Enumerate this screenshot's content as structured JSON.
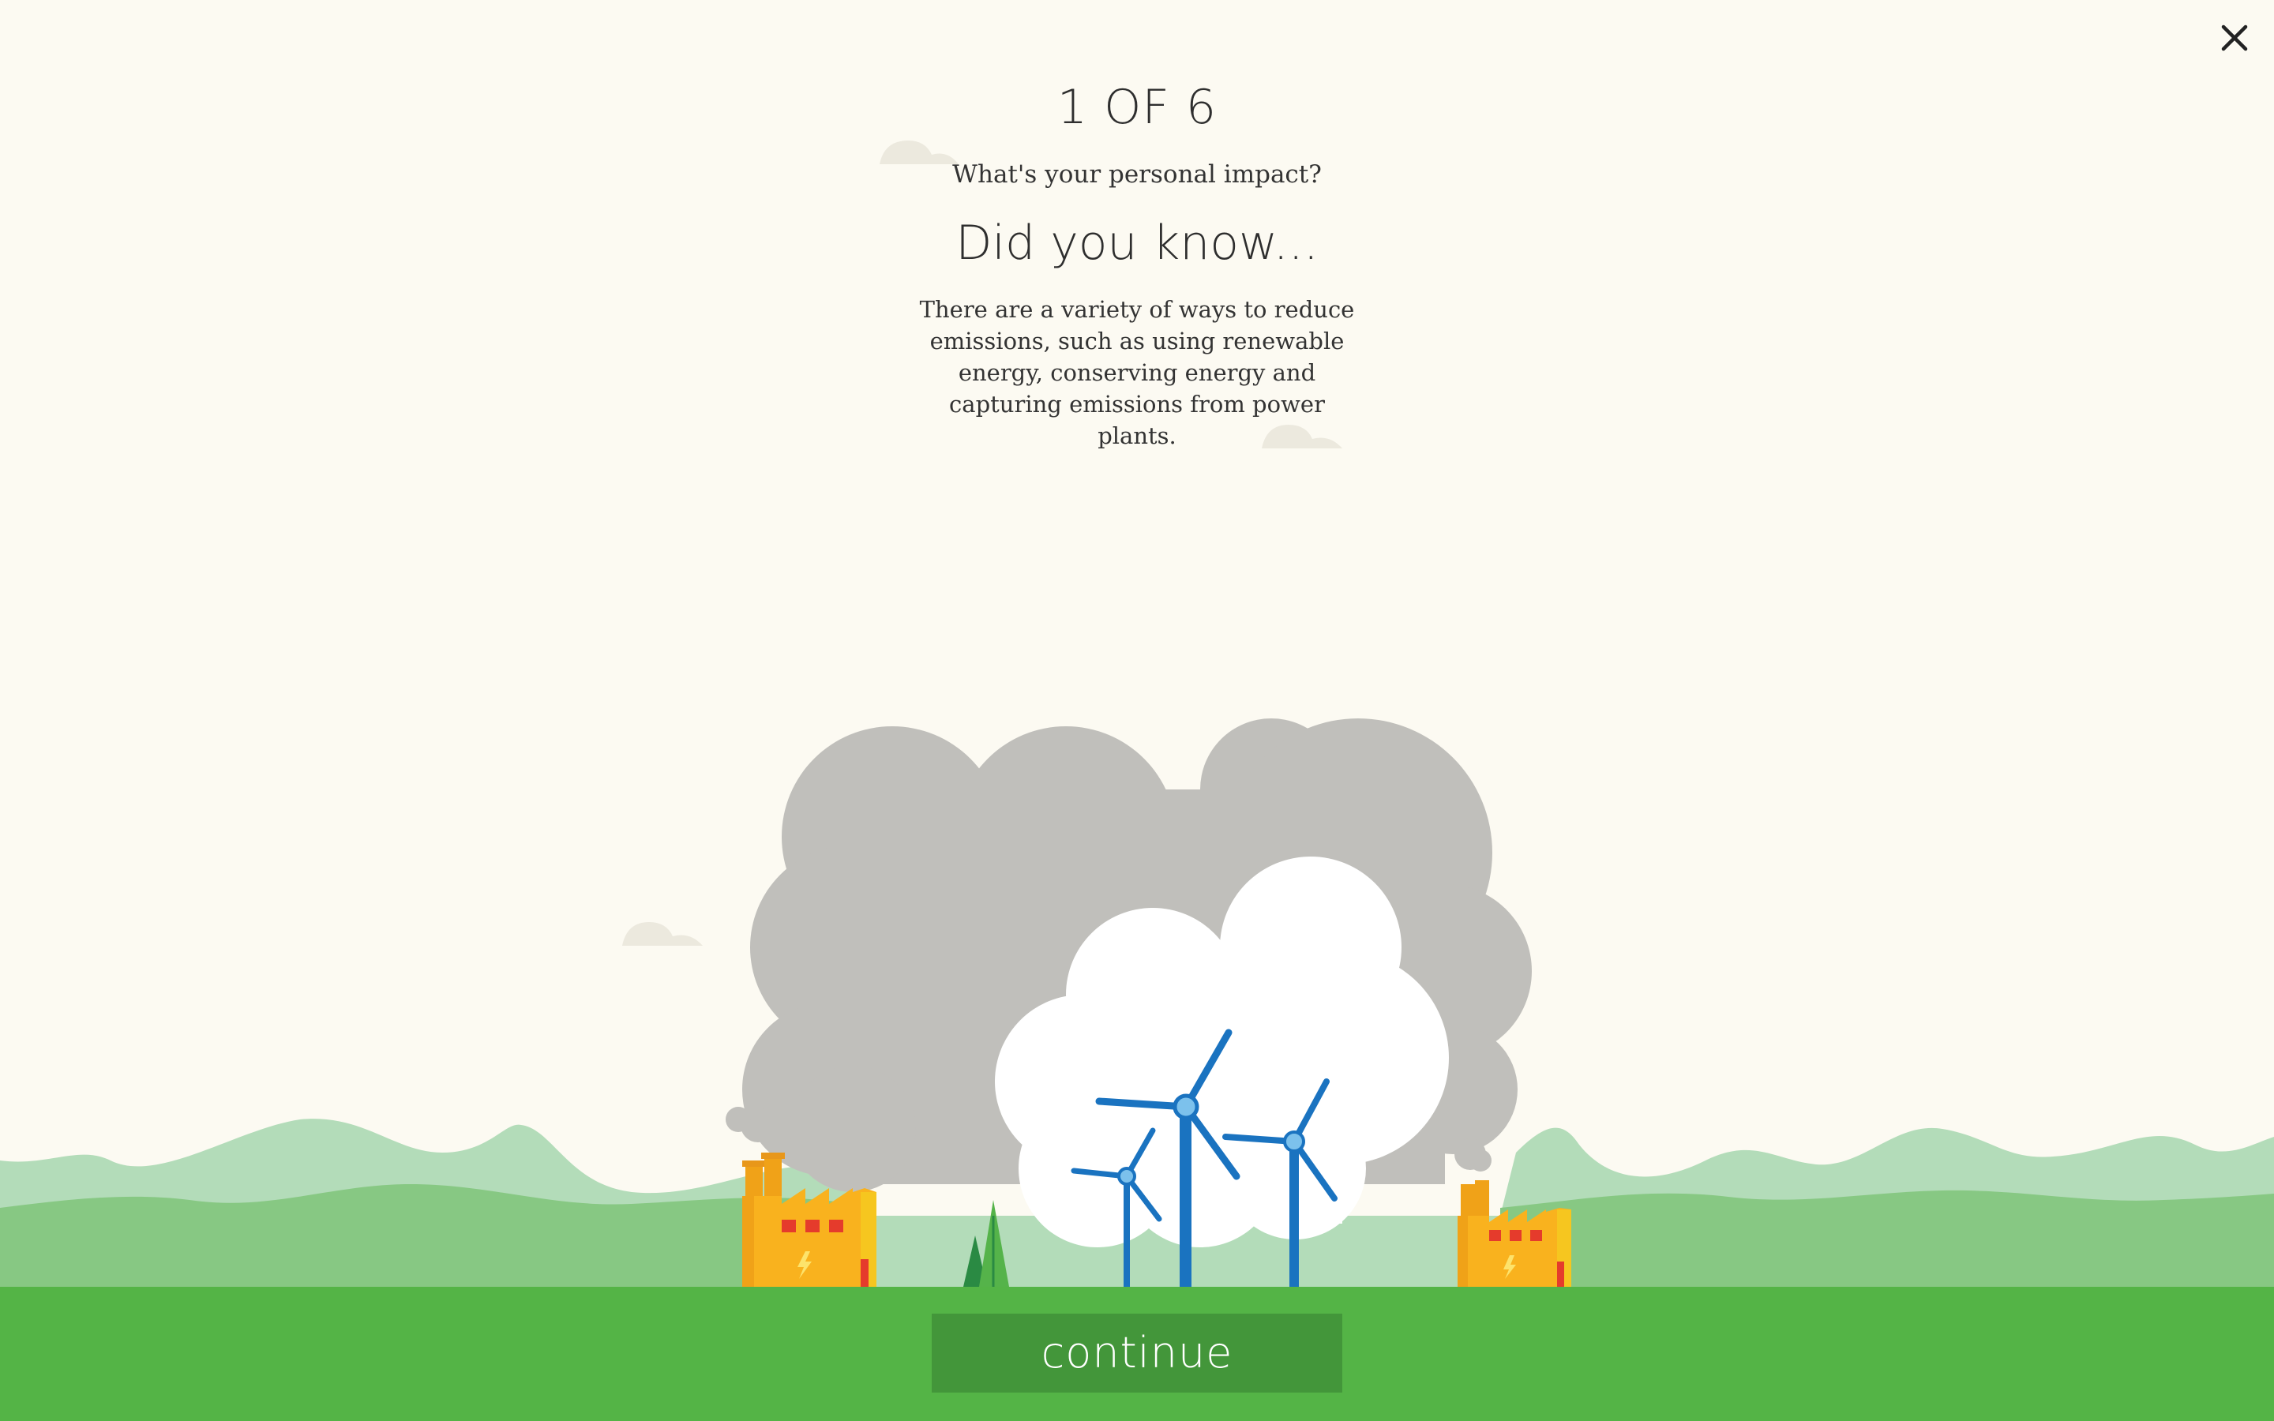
{
  "progress": {
    "text": "1 OF 6",
    "current": 1,
    "total": 6
  },
  "subtitle": "What's your personal impact?",
  "heading": "Did you know...",
  "body": "There are a variety of ways to reduce emissions, such as using renewable energy, conserving energy and capturing emissions from power plants.",
  "continue_label": "continue",
  "close_icon": "close-icon",
  "colors": {
    "background": "#fcfaf2",
    "ground": "#54b446",
    "button": "#43963a",
    "smoke": "#c0bfbb",
    "turbine": "#1a73c0",
    "factory": "#f5a518"
  }
}
